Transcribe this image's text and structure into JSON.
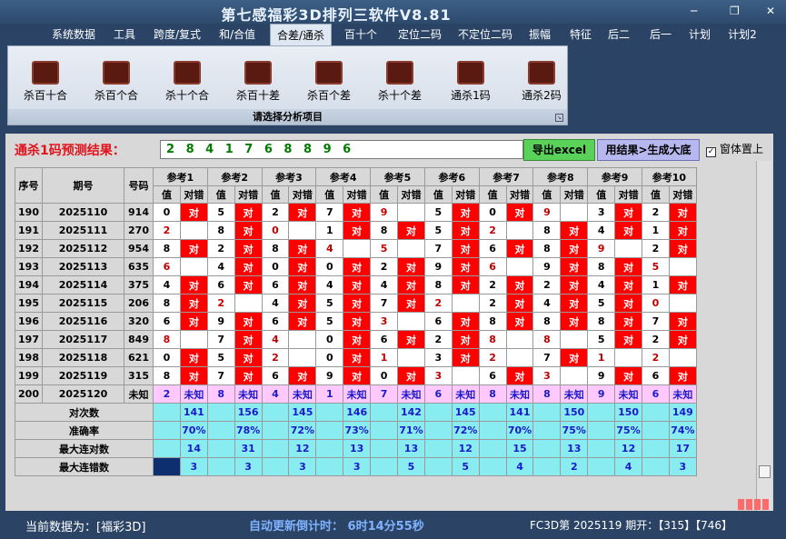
{
  "app": {
    "title": "第七感福彩3D排列三软件V8.81"
  },
  "menu": [
    "系统数据",
    "工具",
    "跨度/复式",
    "和/合值",
    "合差/通杀",
    "百十个",
    "定位二码",
    "不定位二码",
    "振幅",
    "特征",
    "后二",
    "后一",
    "计划",
    "计划2"
  ],
  "active_menu": "合差/通杀",
  "ribbon": {
    "buttons": [
      "杀百十合",
      "杀百个合",
      "杀十个合",
      "杀百十差",
      "杀百个差",
      "杀十个差",
      "通杀1码",
      "通杀2码"
    ],
    "footer": "请选择分析项目"
  },
  "prediction": {
    "label": "通杀1码预测结果：",
    "values": "2 8 4 1 7 6 8 8 9 6"
  },
  "buttons": {
    "export": "导出excel",
    "generate": "用结果>生成大底",
    "topmost": "窗体置上"
  },
  "grid": {
    "headers": {
      "seq": "序号",
      "period": "期号",
      "number": "号码",
      "refs": [
        "参考1",
        "参考2",
        "参考3",
        "参考4",
        "参考5",
        "参考6",
        "参考7",
        "参考8",
        "参考9",
        "参考10"
      ],
      "val": "值",
      "cuo": "对错"
    },
    "rows": [
      {
        "seq": "190",
        "period": "2025110",
        "num": "914",
        "vals": [
          "0",
          "5",
          "2",
          "7",
          "9",
          "5",
          "0",
          "9",
          "3",
          "2"
        ],
        "hits": [
          1,
          1,
          1,
          1,
          0,
          1,
          1,
          0,
          1,
          1
        ],
        "red": [
          0,
          0,
          0,
          0,
          1,
          0,
          0,
          1,
          0,
          0
        ]
      },
      {
        "seq": "191",
        "period": "2025111",
        "num": "270",
        "vals": [
          "2",
          "8",
          "0",
          "1",
          "8",
          "5",
          "2",
          "8",
          "4",
          "1"
        ],
        "hits": [
          0,
          1,
          0,
          1,
          1,
          1,
          0,
          1,
          1,
          1
        ],
        "red": [
          1,
          0,
          1,
          0,
          0,
          0,
          1,
          0,
          0,
          0
        ]
      },
      {
        "seq": "192",
        "period": "2025112",
        "num": "954",
        "vals": [
          "8",
          "2",
          "8",
          "4",
          "5",
          "7",
          "6",
          "8",
          "9",
          "2"
        ],
        "hits": [
          1,
          1,
          1,
          0,
          0,
          1,
          1,
          1,
          0,
          1
        ],
        "red": [
          0,
          0,
          0,
          1,
          1,
          0,
          0,
          0,
          1,
          0
        ]
      },
      {
        "seq": "193",
        "period": "2025113",
        "num": "635",
        "vals": [
          "6",
          "4",
          "0",
          "0",
          "2",
          "9",
          "6",
          "9",
          "8",
          "5"
        ],
        "hits": [
          0,
          1,
          1,
          1,
          1,
          1,
          0,
          1,
          1,
          0
        ],
        "red": [
          1,
          0,
          0,
          0,
          0,
          0,
          1,
          0,
          0,
          1
        ]
      },
      {
        "seq": "194",
        "period": "2025114",
        "num": "375",
        "vals": [
          "4",
          "6",
          "6",
          "4",
          "4",
          "8",
          "2",
          "2",
          "4",
          "1"
        ],
        "hits": [
          1,
          1,
          1,
          1,
          1,
          1,
          1,
          1,
          1,
          1
        ],
        "red": [
          0,
          0,
          0,
          0,
          0,
          0,
          0,
          0,
          0,
          0
        ]
      },
      {
        "seq": "195",
        "period": "2025115",
        "num": "206",
        "vals": [
          "8",
          "2",
          "4",
          "5",
          "7",
          "2",
          "2",
          "4",
          "5",
          "0"
        ],
        "hits": [
          1,
          0,
          1,
          1,
          1,
          0,
          1,
          1,
          1,
          0
        ],
        "red": [
          0,
          1,
          0,
          0,
          0,
          1,
          0,
          0,
          0,
          1
        ]
      },
      {
        "seq": "196",
        "period": "2025116",
        "num": "320",
        "vals": [
          "6",
          "9",
          "6",
          "5",
          "3",
          "6",
          "8",
          "8",
          "8",
          "7"
        ],
        "hits": [
          1,
          1,
          1,
          1,
          0,
          1,
          1,
          1,
          1,
          1
        ],
        "red": [
          0,
          0,
          0,
          0,
          1,
          0,
          0,
          0,
          0,
          0
        ]
      },
      {
        "seq": "197",
        "period": "2025117",
        "num": "849",
        "vals": [
          "8",
          "7",
          "4",
          "0",
          "6",
          "2",
          "8",
          "8",
          "5",
          "2"
        ],
        "hits": [
          0,
          1,
          0,
          1,
          1,
          1,
          0,
          0,
          1,
          1
        ],
        "red": [
          1,
          0,
          1,
          0,
          0,
          0,
          1,
          1,
          0,
          0
        ]
      },
      {
        "seq": "198",
        "period": "2025118",
        "num": "621",
        "vals": [
          "0",
          "5",
          "2",
          "0",
          "1",
          "3",
          "2",
          "7",
          "1",
          "2"
        ],
        "hits": [
          1,
          1,
          0,
          1,
          0,
          1,
          0,
          1,
          0,
          0
        ],
        "red": [
          0,
          0,
          1,
          0,
          1,
          0,
          1,
          0,
          1,
          1
        ]
      },
      {
        "seq": "199",
        "period": "2025119",
        "num": "315",
        "vals": [
          "8",
          "7",
          "6",
          "9",
          "0",
          "3",
          "6",
          "3",
          "9",
          "6"
        ],
        "hits": [
          1,
          1,
          1,
          1,
          1,
          0,
          1,
          0,
          1,
          1
        ],
        "red": [
          0,
          0,
          0,
          0,
          0,
          1,
          0,
          1,
          0,
          0
        ]
      }
    ],
    "unknown_row": {
      "seq": "200",
      "period": "2025120",
      "num": "未知",
      "vals": [
        "2",
        "8",
        "4",
        "1",
        "7",
        "6",
        "8",
        "8",
        "9",
        "6"
      ],
      "status": "未知"
    },
    "stats": [
      {
        "label": "对次数",
        "vals": [
          "141",
          "156",
          "145",
          "146",
          "142",
          "145",
          "141",
          "150",
          "150",
          "149"
        ]
      },
      {
        "label": "准确率",
        "vals": [
          "70%",
          "78%",
          "72%",
          "73%",
          "71%",
          "72%",
          "70%",
          "75%",
          "75%",
          "74%"
        ]
      },
      {
        "label": "最大连对数",
        "vals": [
          "14",
          "31",
          "12",
          "13",
          "13",
          "12",
          "15",
          "13",
          "12",
          "17"
        ]
      },
      {
        "label": "最大连错数",
        "vals": [
          "3",
          "3",
          "3",
          "3",
          "5",
          "5",
          "4",
          "2",
          "4",
          "3"
        ]
      }
    ],
    "hit_text": "对"
  },
  "status": {
    "data": "当前数据为：[福彩3D]",
    "countdown": "自动更新倒计时：  6时14分55秒",
    "fc": "FC3D第 2025119 期开：【315】【746】"
  }
}
